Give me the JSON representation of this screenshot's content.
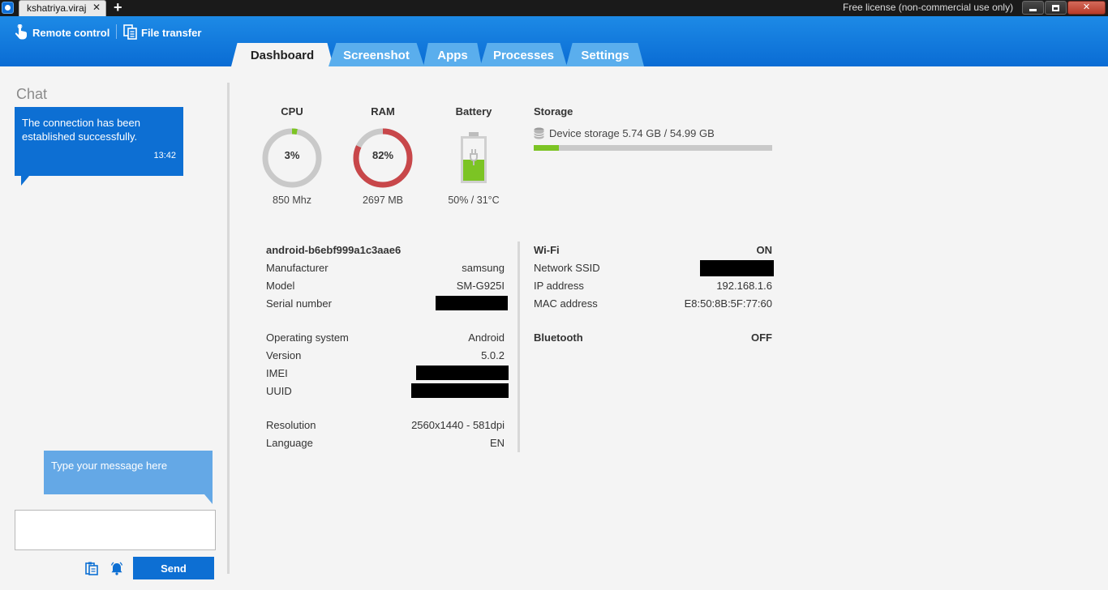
{
  "window": {
    "tab_title": "kshatriya.viraj",
    "tab_close": "✕",
    "new_tab": "+",
    "license": "Free license (non-commercial use only)",
    "close": "✕"
  },
  "toolbar": {
    "remote_control": "Remote control",
    "file_transfer": "File transfer"
  },
  "tabs": [
    {
      "label": "Dashboard",
      "active": true
    },
    {
      "label": "Screenshot",
      "active": false
    },
    {
      "label": "Apps",
      "active": false
    },
    {
      "label": "Processes",
      "active": false
    },
    {
      "label": "Settings",
      "active": false
    }
  ],
  "chat": {
    "title": "Chat",
    "message": "The connection has been established successfully.",
    "time": "13:42",
    "hint": "Type your message here",
    "input_value": "",
    "send": "Send"
  },
  "gauges": {
    "cpu": {
      "label": "CPU",
      "percent_text": "3%",
      "percent": 3,
      "sub": "850 Mhz",
      "color": "#7cc424"
    },
    "ram": {
      "label": "RAM",
      "percent_text": "82%",
      "percent": 82,
      "sub": "2697 MB",
      "color": "#c8474a"
    },
    "battery": {
      "label": "Battery",
      "level": 50,
      "sub": "50% / 31°C",
      "color": "#7cc424"
    }
  },
  "storage": {
    "title": "Storage",
    "text": "Device storage 5.74 GB / 54.99 GB",
    "used_fraction": 0.104,
    "bar_color": "#7cc424"
  },
  "device": {
    "name": "android-b6ebf999a1c3aae6",
    "manufacturer": {
      "key": "Manufacturer",
      "value": "samsung"
    },
    "model": {
      "key": "Model",
      "value": "SM-G925I"
    },
    "serial": {
      "key": "Serial number"
    },
    "os": {
      "key": "Operating system",
      "value": "Android"
    },
    "version": {
      "key": "Version",
      "value": "5.0.2"
    },
    "imei": {
      "key": "IMEI"
    },
    "uuid": {
      "key": "UUID"
    },
    "resolution": {
      "key": "Resolution",
      "value": "2560x1440 - 581dpi"
    },
    "language": {
      "key": "Language",
      "value": "EN"
    }
  },
  "network": {
    "wifi": {
      "key": "Wi-Fi",
      "value": "ON"
    },
    "ssid": {
      "key": "Network SSID"
    },
    "ip": {
      "key": "IP address",
      "value": "192.168.1.6"
    },
    "mac": {
      "key": "MAC address",
      "value": "E8:50:8B:5F:77:60"
    },
    "bluetooth": {
      "key": "Bluetooth",
      "value": "OFF"
    }
  }
}
